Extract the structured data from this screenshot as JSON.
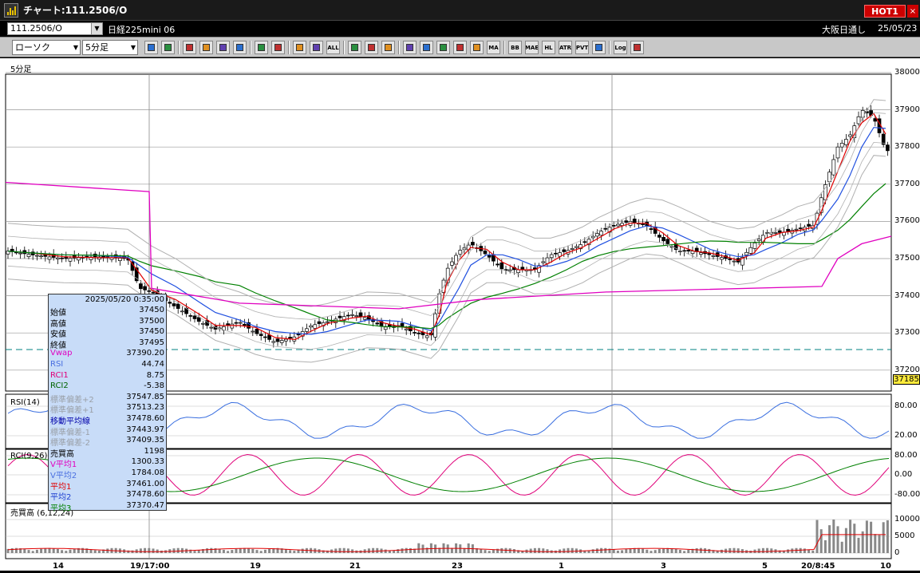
{
  "window": {
    "title": "チャート:111.2506/O",
    "hot_label": "HOT1",
    "close_label": "×"
  },
  "header": {
    "symbol_code": "111.2506/O",
    "symbol_name": "日経225mini 06",
    "market": "大阪日通し",
    "date": "25/05/23"
  },
  "toolbar": {
    "chart_type": "ローソク",
    "timeframe": "5分足",
    "buttons": [
      "search",
      "window",
      "pen",
      "link",
      "cursor",
      "redo",
      "page",
      "trash",
      "candle-a",
      "candle-b",
      "all",
      "gear",
      "wrench",
      "palette",
      "flag",
      "zoom",
      "bars-a",
      "bars-b",
      "lock",
      "ma",
      "bb",
      "mae",
      "hl",
      "atr",
      "pvt",
      "box",
      "log",
      "screen"
    ],
    "button_texts": {
      "all": "ALL",
      "ma": "MA",
      "bb": "BB",
      "mae": "MAE",
      "hl": "HL",
      "atr": "ATR",
      "pvt": "PVT",
      "log": "Log"
    }
  },
  "main_pane": {
    "label": "5分足",
    "y_ticks": [
      "38000",
      "37900",
      "37800",
      "37700",
      "37600",
      "37500",
      "37400",
      "37300",
      "37200"
    ],
    "current_price_tag": "37185"
  },
  "rsi_pane": {
    "label": "RSI(14)",
    "y_ticks": [
      "80.00",
      "20.00"
    ]
  },
  "rci_pane": {
    "label": "RCI(9,26)",
    "y_ticks": [
      "80.00",
      "0.00",
      "-80.00"
    ]
  },
  "volume_pane": {
    "label": "売買高 (6,12,24)",
    "y_ticks": [
      "10000",
      "5000",
      "0"
    ]
  },
  "x_axis": {
    "labels": [
      "14",
      "19/17:00",
      "19",
      "21",
      "23",
      "1",
      "3",
      "5",
      "20/8:45",
      "10"
    ]
  },
  "info_panel": {
    "timestamp": "2025/05/20 0:35:00",
    "rows": [
      {
        "label": "始値",
        "value": "37450",
        "color": "#000000"
      },
      {
        "label": "高値",
        "value": "37500",
        "color": "#000000"
      },
      {
        "label": "安値",
        "value": "37450",
        "color": "#000000"
      },
      {
        "label": "終値",
        "value": "37495",
        "color": "#000000"
      },
      {
        "label": "Vwap",
        "value": "37390.20",
        "color": "#e000c0"
      },
      {
        "label": "RSI",
        "value": "44.74",
        "color": "#4a6fe0"
      },
      {
        "label": "RCI1",
        "value": "8.75",
        "color": "#e0007a"
      },
      {
        "label": "RCI2",
        "value": "-5.38",
        "color": "#006400"
      },
      {
        "label": "標準偏差+2",
        "value": "37547.85",
        "color": "#9aa0a8"
      },
      {
        "label": "標準偏差+1",
        "value": "37513.23",
        "color": "#9aa0a8"
      },
      {
        "label": "移動平均線",
        "value": "37478.60",
        "color": "#0000aa"
      },
      {
        "label": "標準偏差-1",
        "value": "37443.97",
        "color": "#9aa0a8"
      },
      {
        "label": "標準偏差-2",
        "value": "37409.35",
        "color": "#9aa0a8"
      },
      {
        "label": "売買高",
        "value": "1198",
        "color": "#000000"
      },
      {
        "label": "V平均1",
        "value": "1300.33",
        "color": "#e000c0"
      },
      {
        "label": "V平均2",
        "value": "1784.08",
        "color": "#4a6fe0"
      },
      {
        "label": "平均1",
        "value": "37461.00",
        "color": "#e00000"
      },
      {
        "label": "平均2",
        "value": "37478.60",
        "color": "#2040d0"
      },
      {
        "label": "平均3",
        "value": "37370.47",
        "color": "#008000"
      }
    ]
  },
  "colors": {
    "ma1": "#e00000",
    "ma2": "#2050e0",
    "ma3": "#008000",
    "vwap": "#e000c0",
    "bands": "#b0b0b0",
    "candle_up": "#ffffff",
    "candle_down": "#000000",
    "rsi_line": "#3a6fe0",
    "rci_short": "#e0007a",
    "rci_long": "#008000",
    "volume_bar": "#888888",
    "support_line": "#008080"
  }
}
